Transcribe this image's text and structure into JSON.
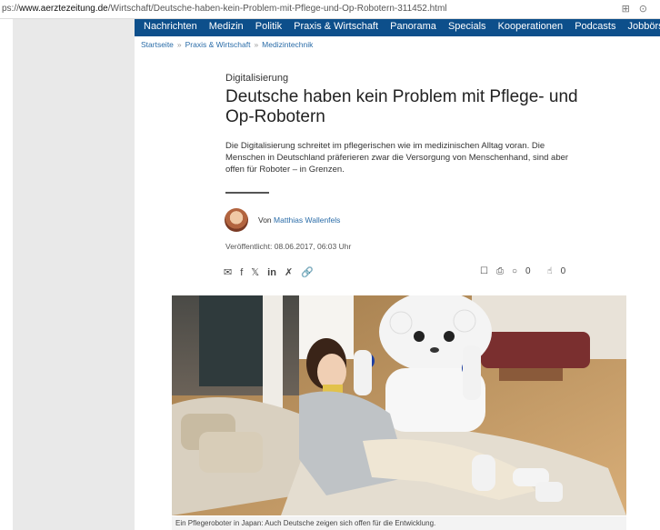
{
  "browser": {
    "url_prefix": "ps://",
    "url_domain": "www.aerztezeitung.de",
    "url_path": "/Wirtschaft/Deutsche-haben-kein-Problem-mit-Pflege-und-Op-Robotern-311452.html"
  },
  "nav": {
    "items": [
      "Nachrichten",
      "Medizin",
      "Politik",
      "Praxis & Wirtschaft",
      "Panorama",
      "Specials",
      "Kooperationen",
      "Podcasts",
      "Jobbörse"
    ]
  },
  "breadcrumb": {
    "items": [
      "Startseite",
      "Praxis & Wirtschaft",
      "Medizintechnik"
    ],
    "separator": "»"
  },
  "article": {
    "kicker": "Digitalisierung",
    "title": "Deutsche haben kein Problem mit Pflege- und Op-Robotern",
    "lead": "Die Digitalisierung schreitet im pflegerischen wie im medizinischen Alltag voran. Die Menschen in Deutschland präferieren zwar die Versorgung von Menschenhand, sind aber offen für Roboter – in Grenzen.",
    "author_prefix": "Von",
    "author_name": "Matthias Wallenfels",
    "published": "Veröffentlicht: 08.06.2017, 06:03 Uhr",
    "comment_count": "0",
    "like_count": "0",
    "caption": "Ein Pflegeroboter in Japan: Auch Deutsche zeigen sich offen für die Entwicklung."
  }
}
